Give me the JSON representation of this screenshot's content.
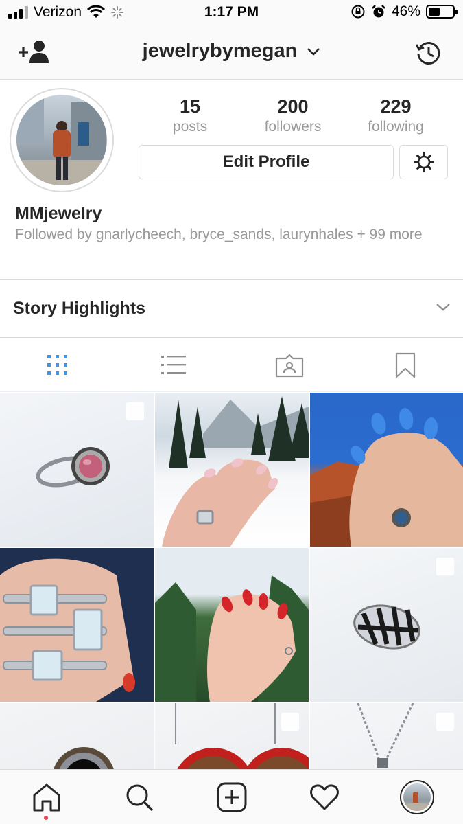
{
  "status_bar": {
    "carrier": "Verizon",
    "time": "1:17 PM",
    "battery": "46%",
    "battery_level": 0.46
  },
  "header": {
    "username": "jewelrybymegan",
    "icons": [
      "add-user-icon",
      "chevron-down-icon",
      "history-icon"
    ]
  },
  "profile": {
    "stats": [
      {
        "value": "15",
        "label": "posts"
      },
      {
        "value": "200",
        "label": "followers"
      },
      {
        "value": "229",
        "label": "following"
      }
    ],
    "edit_button": "Edit Profile",
    "display_name": "MMjewelry",
    "followed_by": "Followed by gnarlycheech, bryce_sands, laurynhales + 99 more"
  },
  "highlights": {
    "title": "Story Highlights"
  },
  "tabs": [
    {
      "icon": "grid-icon",
      "active": true
    },
    {
      "icon": "list-icon",
      "active": false
    },
    {
      "icon": "tagged-icon",
      "active": false
    },
    {
      "icon": "saved-icon",
      "active": false
    }
  ],
  "posts": [
    {
      "subject": "ring-pink-stone",
      "multiple": true
    },
    {
      "subject": "hand-snowy-forest",
      "multiple": false
    },
    {
      "subject": "hand-blue-nails-red-rocks",
      "multiple": false
    },
    {
      "subject": "hand-stacked-rings",
      "multiple": false
    },
    {
      "subject": "hand-red-nails-trees",
      "multiple": false
    },
    {
      "subject": "striped-band-ring",
      "multiple": true
    },
    {
      "subject": "ring-black-stone",
      "multiple": false
    },
    {
      "subject": "red-bead-earrings",
      "multiple": true
    },
    {
      "subject": "necklace",
      "multiple": true
    }
  ],
  "bottom_nav": [
    "home-icon",
    "search-icon",
    "new-post-icon",
    "activity-icon",
    "profile-icon"
  ],
  "colors": {
    "accent_blue": "#3897f0",
    "notification_red": "#ed4956",
    "border": "#dbdbdb",
    "secondary_text": "#999999"
  }
}
